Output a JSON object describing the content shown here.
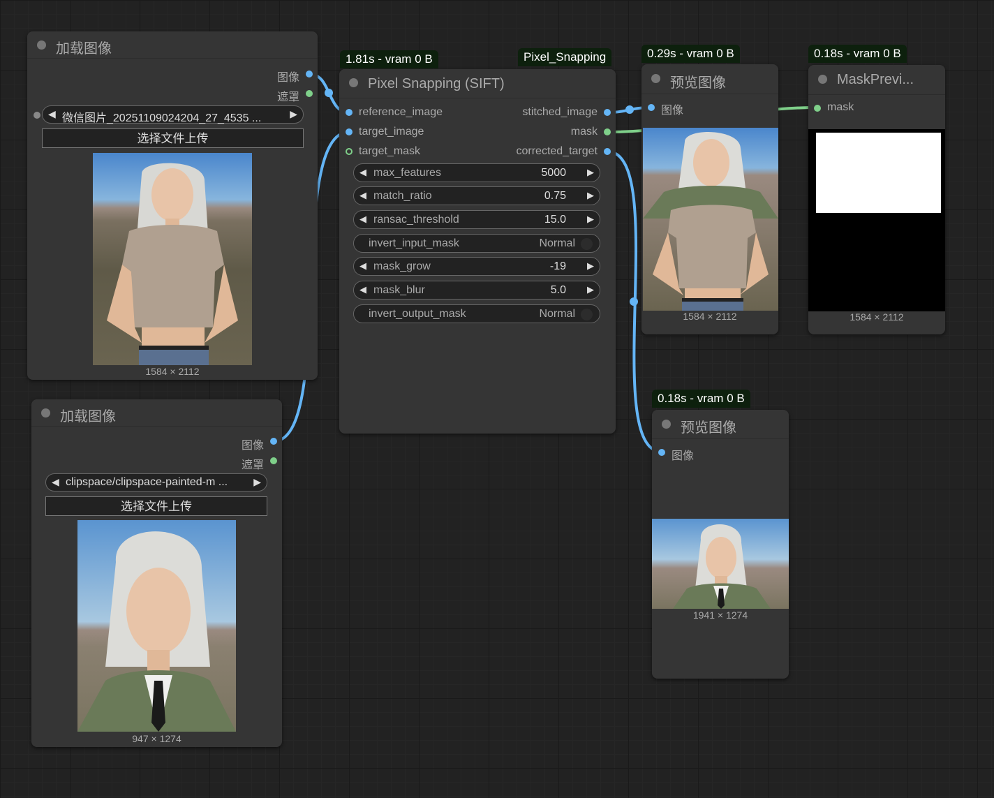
{
  "load1": {
    "title": "加载图像",
    "out_image": "图像",
    "out_mask": "遮罩",
    "file": "微信图片_20251109024204_27_4535 ...",
    "upload": "选择文件上传",
    "dims": "1584 × 2112"
  },
  "load2": {
    "title": "加载图像",
    "out_image": "图像",
    "out_mask": "遮罩",
    "file": "clipspace/clipspace-painted-m ...",
    "upload": "选择文件上传",
    "dims": "947 × 1274"
  },
  "pixel": {
    "badge_time": "1.81s - vram 0 B",
    "badge_name": "Pixel_Snapping",
    "title": "Pixel Snapping (SIFT)",
    "inputs": [
      "reference_image",
      "target_image",
      "target_mask"
    ],
    "outputs": [
      "stitched_image",
      "mask",
      "corrected_target"
    ],
    "widgets": [
      {
        "name": "max_features",
        "value": "5000"
      },
      {
        "name": "match_ratio",
        "value": "0.75"
      },
      {
        "name": "ransac_threshold",
        "value": "15.0"
      },
      {
        "name": "invert_input_mask",
        "value": "Normal"
      },
      {
        "name": "mask_grow",
        "value": "-19"
      },
      {
        "name": "mask_blur",
        "value": "5.0"
      },
      {
        "name": "invert_output_mask",
        "value": "Normal"
      }
    ]
  },
  "preview1": {
    "badge": "0.29s - vram 0 B",
    "title": "预览图像",
    "input": "图像",
    "dims": "1584 × 2112"
  },
  "mask_preview": {
    "badge": "0.18s - vram 0 B",
    "title": "MaskPrevi...",
    "input": "mask",
    "dims": "1584 × 2112"
  },
  "preview2": {
    "badge": "0.18s - vram 0 B",
    "title": "预览图像",
    "input": "图像",
    "dims": "1941 × 1274"
  },
  "colors": {
    "image_link": "#64b5f6",
    "mask_link": "#7fd08a",
    "badge_bg": "#0d200d",
    "node_bg": "#353535",
    "canvas_bg": "#222222"
  }
}
